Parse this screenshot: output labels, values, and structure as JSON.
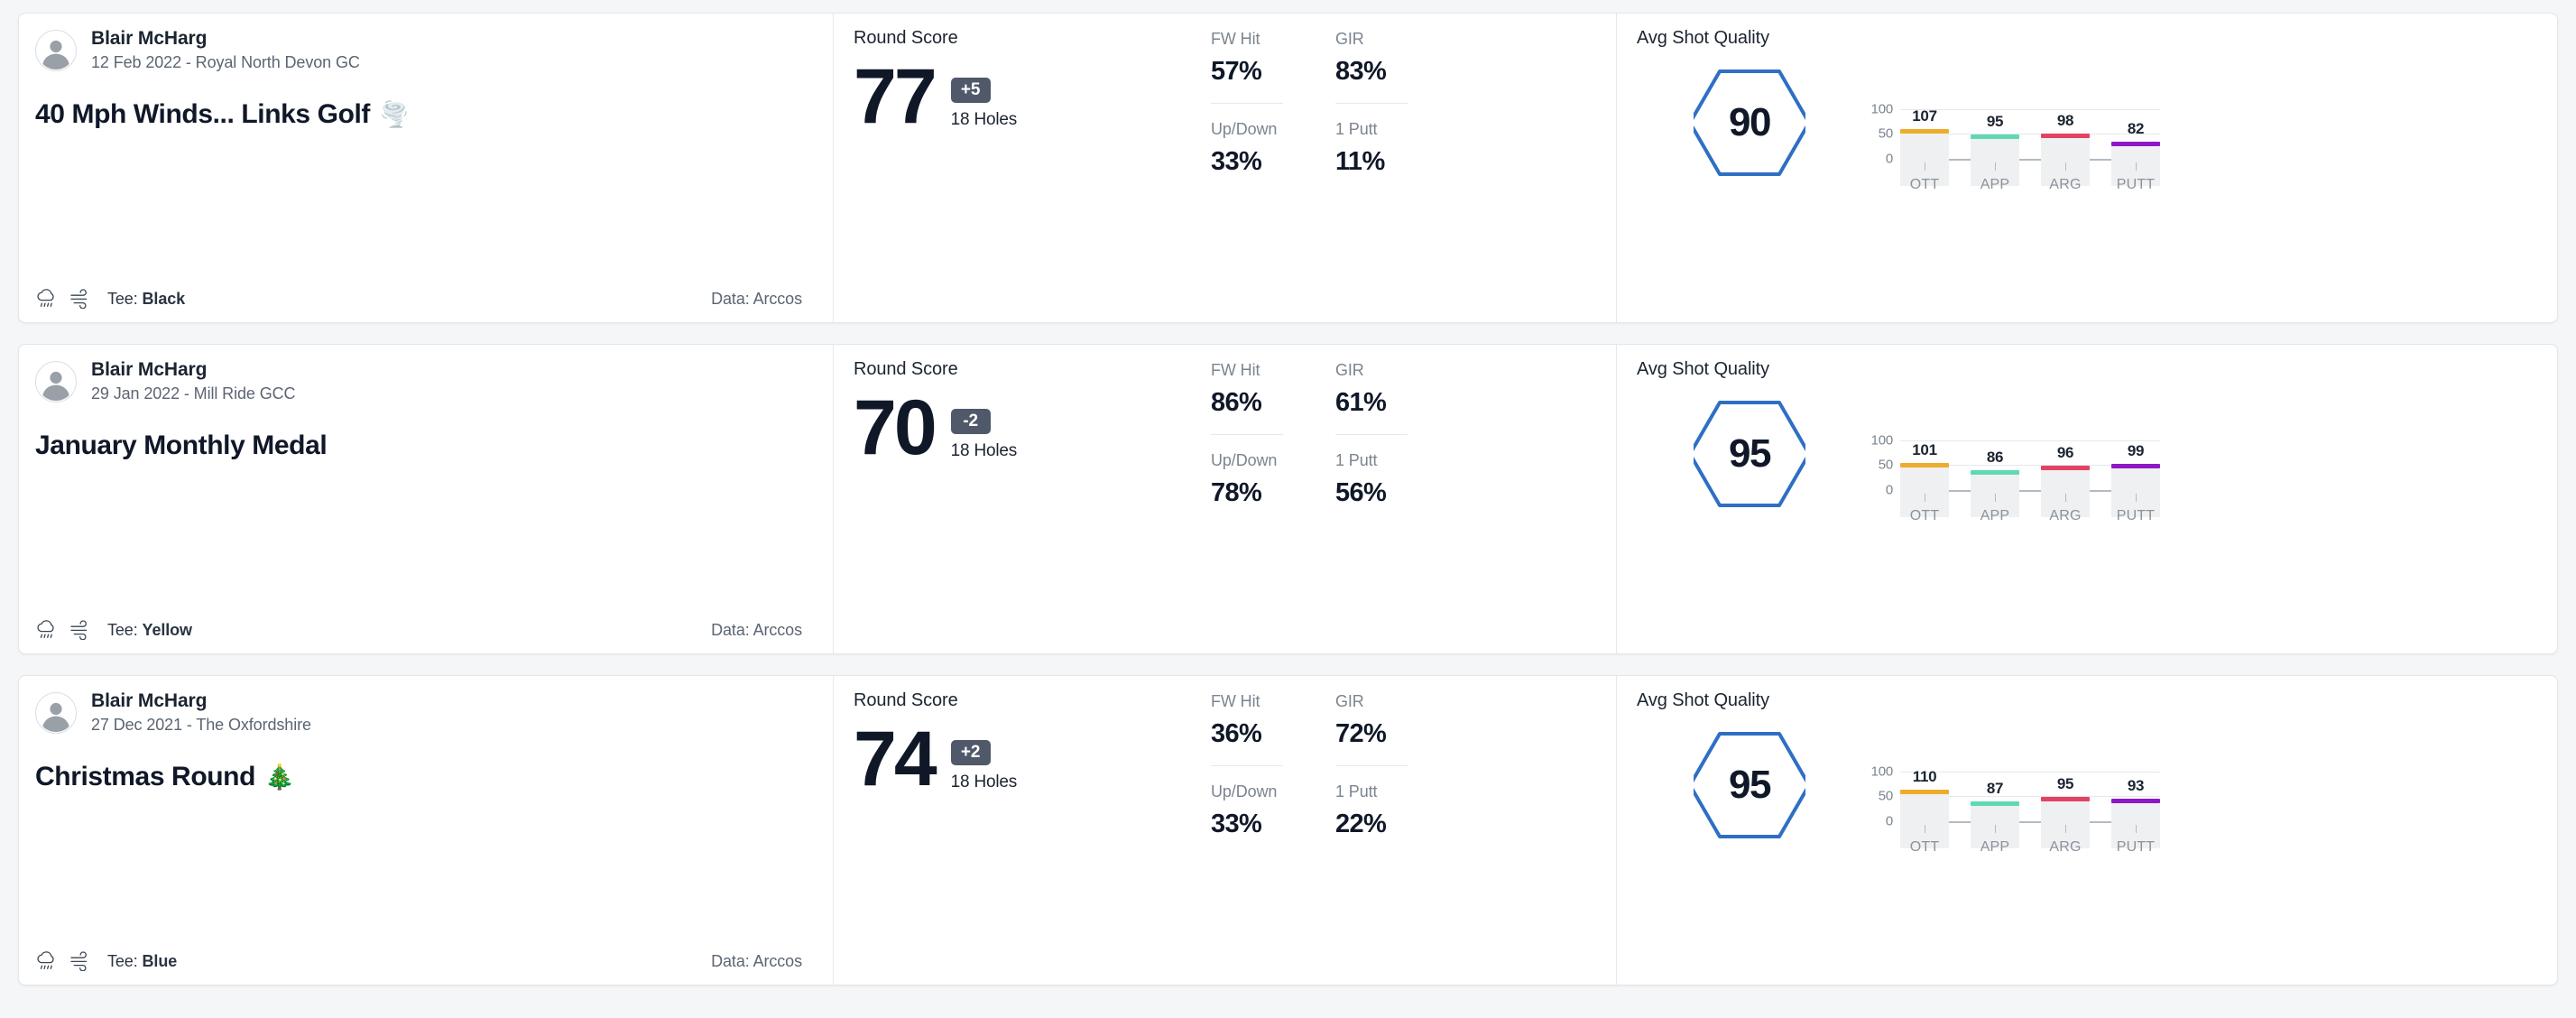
{
  "theme": {
    "card_bg": "#ffffff",
    "page_bg": "#f5f6f7",
    "hex_stroke": "#2e6fc4",
    "diff_badge_bg": "#50596a",
    "bar_track": "#eff0f1",
    "series_colors": {
      "OTT": "#eeac2c",
      "APP": "#5fd9b4",
      "ARG": "#e44263",
      "PUTT": "#8e18c6"
    }
  },
  "labels": {
    "round_score": "Round Score",
    "holes": "18 Holes",
    "avg_shot_quality": "Avg Shot Quality",
    "tee_prefix": "Tee: ",
    "data_prefix": "Data: ",
    "fw_hit": "FW Hit",
    "gir": "GIR",
    "up_down": "Up/Down",
    "one_putt": "1 Putt"
  },
  "icons": {
    "avatar": "person-avatar-icon",
    "weather": "rain-cloud-icon",
    "wind": "wind-icon"
  },
  "rounds": [
    {
      "player": "Blair McHarg",
      "meta": "12 Feb 2022 - Royal North Devon GC",
      "title": "40 Mph Winds... Links Golf",
      "title_emoji": "🌪️",
      "tee_label": "Tee:",
      "tee_value": "Black",
      "data_label": "Data:",
      "data_value": "Arccos",
      "score": "77",
      "diff": "+5",
      "holes": "18 Holes",
      "stats": {
        "fw_hit": "57%",
        "gir": "83%",
        "up_down": "33%",
        "one_putt": "11%"
      },
      "quality_score": "90",
      "chart_data": {
        "type": "bar",
        "title": "Avg Shot Quality",
        "categories": [
          "OTT",
          "APP",
          "ARG",
          "PUTT"
        ],
        "values": [
          107,
          95,
          98,
          82
        ],
        "colors": [
          "#eeac2c",
          "#5fd9b4",
          "#e44263",
          "#8e18c6"
        ],
        "ylim": [
          0,
          130
        ],
        "yticks": [
          0,
          50,
          100
        ],
        "xlabel": "",
        "ylabel": "",
        "grid": true,
        "legend": "none"
      }
    },
    {
      "player": "Blair McHarg",
      "meta": "29 Jan 2022 - Mill Ride GCC",
      "title": "January Monthly Medal",
      "title_emoji": "",
      "tee_label": "Tee:",
      "tee_value": "Yellow",
      "data_label": "Data:",
      "data_value": "Arccos",
      "score": "70",
      "diff": "-2",
      "holes": "18 Holes",
      "stats": {
        "fw_hit": "86%",
        "gir": "61%",
        "up_down": "78%",
        "one_putt": "56%"
      },
      "quality_score": "95",
      "chart_data": {
        "type": "bar",
        "title": "Avg Shot Quality",
        "categories": [
          "OTT",
          "APP",
          "ARG",
          "PUTT"
        ],
        "values": [
          101,
          86,
          96,
          99
        ],
        "colors": [
          "#eeac2c",
          "#5fd9b4",
          "#e44263",
          "#8e18c6"
        ],
        "ylim": [
          0,
          130
        ],
        "yticks": [
          0,
          50,
          100
        ],
        "xlabel": "",
        "ylabel": "",
        "grid": true,
        "legend": "none"
      }
    },
    {
      "player": "Blair McHarg",
      "meta": "27 Dec 2021 - The Oxfordshire",
      "title": "Christmas Round",
      "title_emoji": "🎄",
      "tee_label": "Tee:",
      "tee_value": "Blue",
      "data_label": "Data:",
      "data_value": "Arccos",
      "score": "74",
      "diff": "+2",
      "holes": "18 Holes",
      "stats": {
        "fw_hit": "36%",
        "gir": "72%",
        "up_down": "33%",
        "one_putt": "22%"
      },
      "quality_score": "95",
      "chart_data": {
        "type": "bar",
        "title": "Avg Shot Quality",
        "categories": [
          "OTT",
          "APP",
          "ARG",
          "PUTT"
        ],
        "values": [
          110,
          87,
          95,
          93
        ],
        "colors": [
          "#eeac2c",
          "#5fd9b4",
          "#e44263",
          "#8e18c6"
        ],
        "ylim": [
          0,
          130
        ],
        "yticks": [
          0,
          50,
          100
        ],
        "xlabel": "",
        "ylabel": "",
        "grid": true,
        "legend": "none"
      }
    }
  ]
}
